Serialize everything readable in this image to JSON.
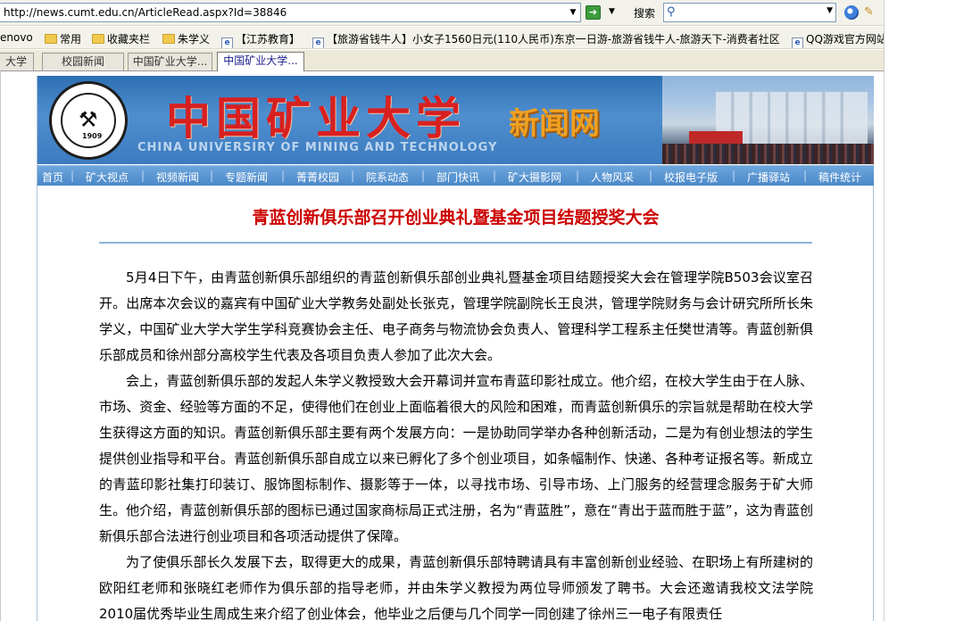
{
  "browser": {
    "address_url": "http://news.cumt.edu.cn/ArticleRead.aspx?Id=38846",
    "search_label": "搜索",
    "search_placeholder": ""
  },
  "favorites": [
    {
      "label": "enovo",
      "type": "none"
    },
    {
      "label": "常用",
      "type": "folder"
    },
    {
      "label": "收藏夹栏",
      "type": "folder"
    },
    {
      "label": "朱学义",
      "type": "folder"
    },
    {
      "label": "【江苏教育】",
      "type": "page"
    },
    {
      "label": "【旅游省钱牛人】小女子1560日元(110人民币)东京一日游-旅游省钱牛人-旅游天下-消费者社区",
      "type": "page"
    },
    {
      "label": "QQ游戏官方网站",
      "type": "page"
    }
  ],
  "tabs": [
    {
      "label": "大学",
      "active": false
    },
    {
      "label": "校园新闻",
      "active": false
    },
    {
      "label": "中国矿业大学...",
      "active": false
    },
    {
      "label": "中国矿业大学...",
      "active": true
    }
  ],
  "site": {
    "logo_text": "CHINA UNIVERSITY OF MINING & TECHNOLOGY",
    "logo_year": "1909",
    "title_cn": "中国矿业大学",
    "title_news": "新闻网",
    "title_en": "CHINA UNIVERSIRY OF MINING AND TECHNOLOGY",
    "nav": [
      "首页",
      "矿大视点",
      "视频新闻",
      "专题新闻",
      "菁菁校园",
      "院系动态",
      "部门快讯",
      "矿大摄影网",
      "人物风采",
      "校报电子版",
      "广播驿站",
      "稿件统计"
    ]
  },
  "article": {
    "title": "青蓝创新俱乐部召开创业典礼暨基金项目结题授奖大会",
    "paragraphs": [
      "5月4日下午，由青蓝创新俱乐部组织的青蓝创新俱乐部创业典礼暨基金项目结题授奖大会在管理学院B503会议室召开。出席本次会议的嘉宾有中国矿业大学教务处副处长张克，管理学院副院长王良洪，管理学院财务与会计研究所所长朱学义，中国矿业大学大学生学科竞赛协会主任、电子商务与物流协会负责人、管理科学工程系主任樊世清等。青蓝创新俱乐部成员和徐州部分高校学生代表及各项目负责人参加了此次大会。",
      "会上，青蓝创新俱乐部的发起人朱学义教授致大会开幕词并宣布青蓝印影社成立。他介绍，在校大学生由于在人脉、市场、资金、经验等方面的不足，使得他们在创业上面临着很大的风险和困难，而青蓝创新俱乐的宗旨就是帮助在校大学生获得这方面的知识。青蓝创新俱乐部主要有两个发展方向：一是协助同学举办各种创新活动，二是为有创业想法的学生提供创业指导和平台。青蓝创新俱乐部自成立以来已孵化了多个创业项目，如条幅制作、快递、各种考证报名等。新成立的青蓝印影社集打印装订、服饰图标制作、摄影等于一体，以寻找市场、引导市场、上门服务的经营理念服务于矿大师生。他介绍，青蓝创新俱乐部的图标已通过国家商标局正式注册，名为“青蓝胜”，意在“青出于蓝而胜于蓝”，这为青蓝创新俱乐部合法进行创业项目和各项活动提供了保障。",
      "为了使俱乐部长久发展下去，取得更大的成果，青蓝创新俱乐部特聘请具有丰富创新创业经验、在职场上有所建树的欧阳红老师和张晓红老师作为俱乐部的指导老师，并由朱学义教授为两位导师颁发了聘书。大会还邀请我校文法学院2010届优秀毕业生周成生来介绍了创业体会，他毕业之后便与几个同学一同创建了徐州三一电子有限责任"
    ]
  }
}
